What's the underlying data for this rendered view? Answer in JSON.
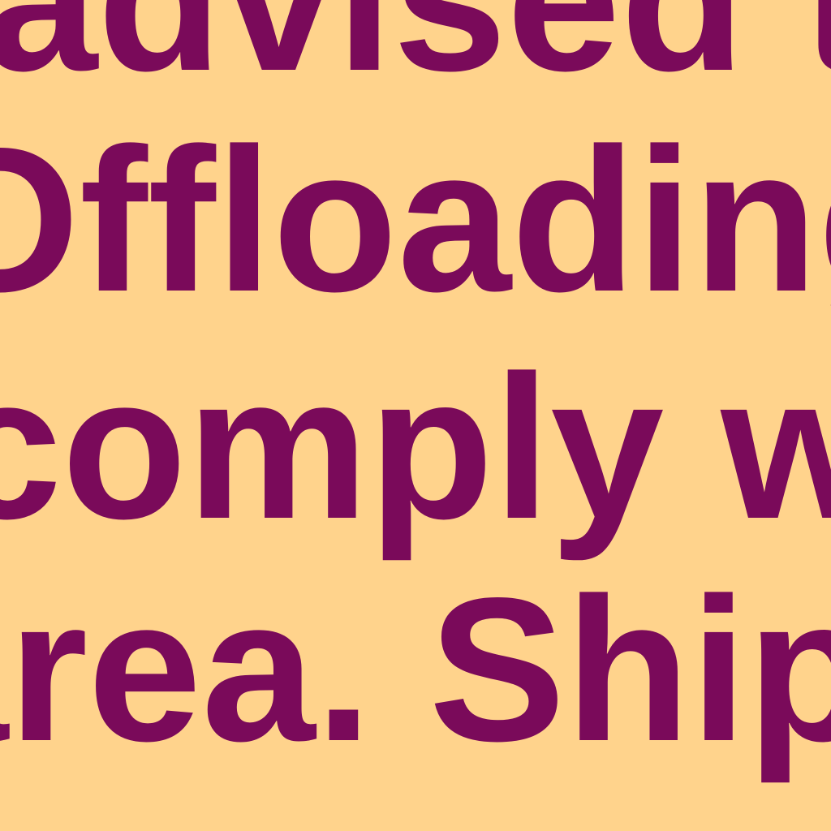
{
  "colors": {
    "background": "#ffd38c",
    "text": "#7a0a5a"
  },
  "text_lines": [
    "advised to",
    "Offloading",
    "comply w",
    "area. Ship"
  ]
}
